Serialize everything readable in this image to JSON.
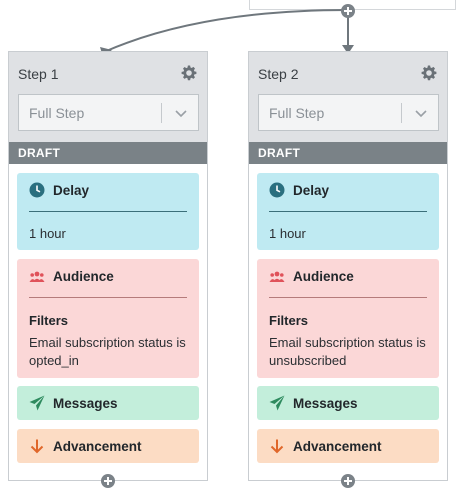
{
  "steps": [
    {
      "title": "Step 1",
      "select_value": "Full Step",
      "status": "DRAFT",
      "delay": {
        "title": "Delay",
        "value": "1 hour"
      },
      "audience": {
        "title": "Audience",
        "filters_label": "Filters",
        "filter_text": "Email subscription status is opted_in"
      },
      "messages": {
        "title": "Messages"
      },
      "advancement": {
        "title": "Advancement"
      }
    },
    {
      "title": "Step 2",
      "select_value": "Full Step",
      "status": "DRAFT",
      "delay": {
        "title": "Delay",
        "value": "1 hour"
      },
      "audience": {
        "title": "Audience",
        "filters_label": "Filters",
        "filter_text": "Email subscription status is unsubscribed"
      },
      "messages": {
        "title": "Messages"
      },
      "advancement": {
        "title": "Advancement"
      }
    }
  ],
  "colors": {
    "delay_bg": "#bfeaf2",
    "audience_bg": "#fbd7d7",
    "messages_bg": "#c3eedb",
    "advancement_bg": "#fcdcc4",
    "draft_bar": "#7a8287",
    "connector": "#6f777d"
  },
  "icons": {
    "gear": "gear-icon",
    "chevron": "chevron-down-icon",
    "delay": "clock-icon",
    "audience": "users-icon",
    "messages": "paper-plane-icon",
    "advancement": "arrow-down-icon",
    "add": "plus-circle-icon"
  }
}
